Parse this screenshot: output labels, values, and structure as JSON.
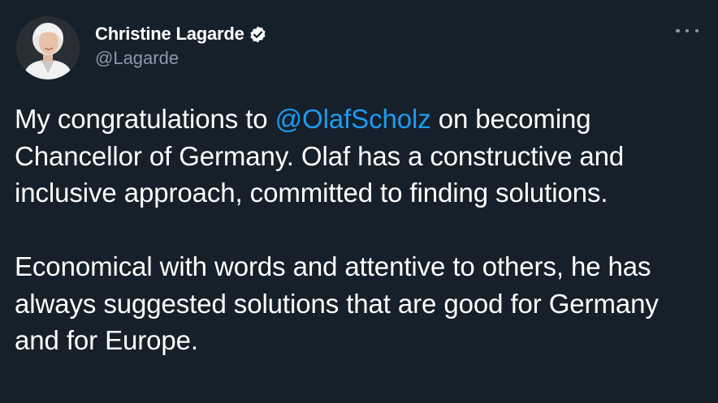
{
  "tweet": {
    "author": {
      "display_name": "Christine Lagarde",
      "handle": "@Lagarde",
      "verified": true,
      "avatar_icon": "profile-photo"
    },
    "menu_icon": "more-horizontal-icon",
    "paragraph1": {
      "before": "My congratulations to ",
      "mention": "@OlafScholz",
      "after": " on becoming Chancellor of Germany. Olaf has a constructive and inclusive approach, committed to finding solutions."
    },
    "paragraph2": "Economical with words and attentive to others, he has always suggested solutions that are good for Germany and for Europe."
  },
  "colors": {
    "background": "#15202b",
    "text_primary": "#ffffff",
    "text_secondary": "#8b98a5",
    "accent": "#1d9bf0"
  }
}
